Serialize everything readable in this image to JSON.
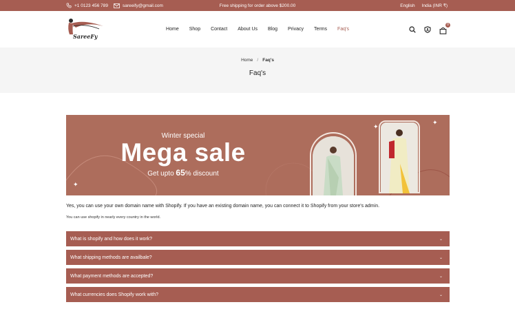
{
  "topbar": {
    "phone": "+1 0123 456 789",
    "email": "sareeify@gmail.com",
    "announcement": "Free shipping for order above $200.00",
    "language": "English",
    "currency": "India (INR ₹)"
  },
  "brand": {
    "logo_text": "SareeFy"
  },
  "nav": {
    "items": [
      {
        "label": "Home"
      },
      {
        "label": "Shop"
      },
      {
        "label": "Contact"
      },
      {
        "label": "About Us"
      },
      {
        "label": "Blog"
      },
      {
        "label": "Privacy"
      },
      {
        "label": "Terms"
      },
      {
        "label": "Faq's"
      }
    ],
    "active": "Faq's"
  },
  "header_icons": {
    "cart_count": "0"
  },
  "breadcrumb": {
    "home": "Home",
    "separator": "/",
    "current": "Faq's"
  },
  "page": {
    "title": "Faq's"
  },
  "banner": {
    "subtitle": "Winter special",
    "headline": "Mega sale",
    "discount_prefix": "Get upto ",
    "discount_value": "65",
    "discount_suffix": "% discount"
  },
  "content": {
    "paragraph": "Yes, you can use your own domain name with Shopify. If you have an existing domain name, you can connect it to Shopify from your store's admin.",
    "note": "You can use shopify in nearly every country in the world."
  },
  "faqs": [
    {
      "question": "What is shopify and how does it work?"
    },
    {
      "question": "What shipping methods are availbale?"
    },
    {
      "question": "What payment methods are accepted?"
    },
    {
      "question": "What currencies does Shopify work with?"
    }
  ],
  "colors": {
    "brand": "#a65d52",
    "banner": "#ad6d5c",
    "breadcrumb_bg": "#f5f5f5"
  }
}
